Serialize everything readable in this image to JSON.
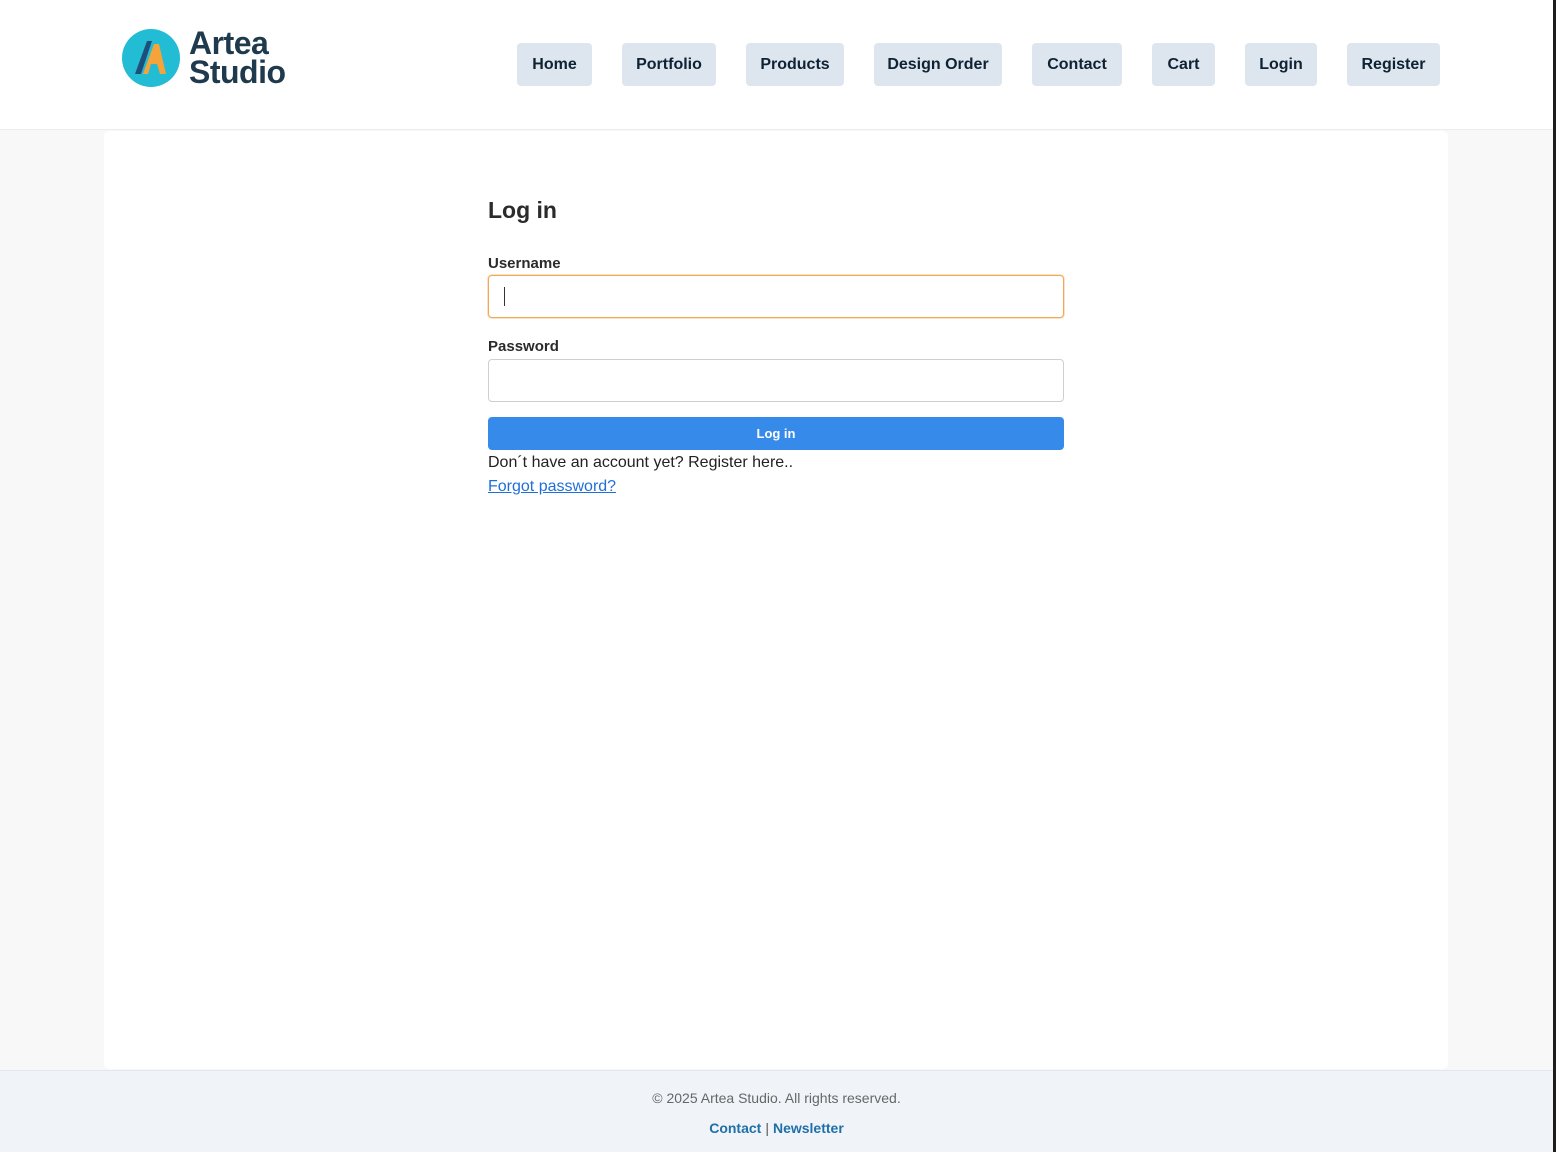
{
  "brand": {
    "name_line1": "Artea",
    "name_line2": "Studio",
    "colors": {
      "circle": "#22bcd4",
      "letter_orange": "#f4a43a",
      "letter_navy": "#1f4e7a",
      "text": "#1f3a4d"
    }
  },
  "nav": {
    "items": [
      {
        "label": "Home"
      },
      {
        "label": "Portfolio"
      },
      {
        "label": "Products"
      },
      {
        "label": "Design Order"
      },
      {
        "label": "Contact"
      },
      {
        "label": "Cart"
      },
      {
        "label": "Login"
      },
      {
        "label": "Register"
      }
    ]
  },
  "login": {
    "title": "Log in",
    "username_label": "Username",
    "username_value": "",
    "password_label": "Password",
    "password_value": "",
    "submit_label": "Log in",
    "register_text": "Don´t have an account yet? Register here..",
    "forgot_label": "Forgot password?"
  },
  "footer": {
    "copyright": "© 2025 Artea Studio. All rights reserved.",
    "links": [
      {
        "label": "Contact"
      },
      {
        "label": "Newsletter"
      }
    ],
    "separator": "|"
  },
  "colors": {
    "accent": "#368bea",
    "nav_button_bg": "#dde6ee",
    "focus_border": "#f0a85a"
  }
}
